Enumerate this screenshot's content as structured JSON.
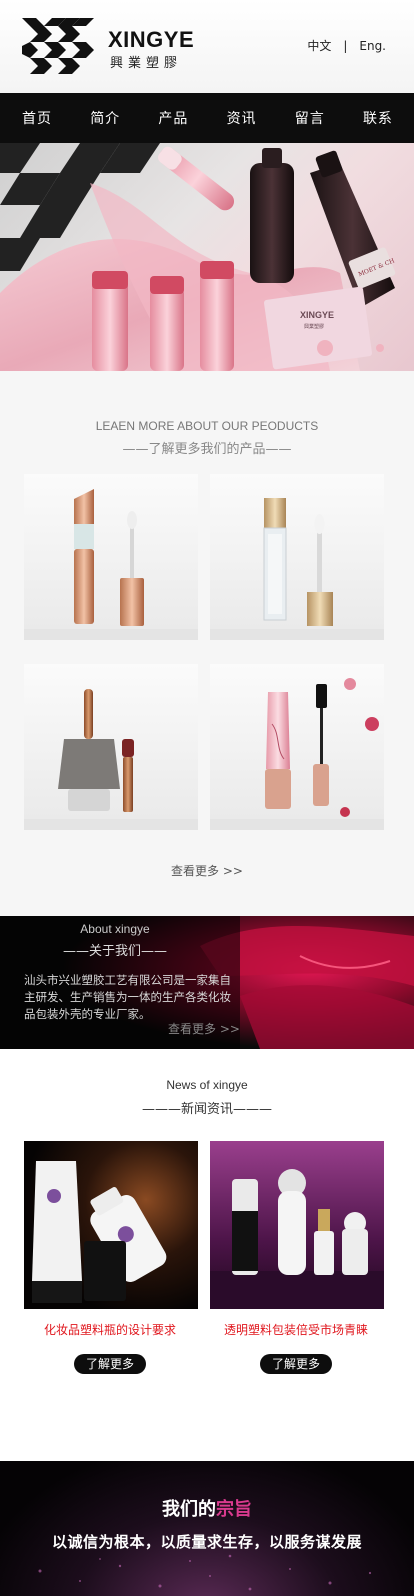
{
  "header": {
    "brand": "XINGYE",
    "brand_cn": "興業塑膠",
    "lang_cn": "中文",
    "lang_sep": "|",
    "lang_en": "Eng."
  },
  "nav": [
    "首页",
    "简介",
    "产品",
    "资讯",
    "留言",
    "联系"
  ],
  "banner": {
    "box_brand": "XINGYE",
    "box_brand_cn": "興業塑膠",
    "bottle_label": "MOET & CH"
  },
  "products": {
    "title_en": "LEAEN MORE ABOUT OUR PEODUCTS",
    "title_cn": "——了解更多我们的产品——",
    "more": "查看更多 >>"
  },
  "about": {
    "title_en": "About xingye",
    "title_cn": "——关于我们——",
    "text": "汕头市兴业塑胶工艺有限公司是一家集自主研发、生产销售为一体的生产各类化妆品包装外壳的专业厂家。",
    "more": "查看更多 >>"
  },
  "news": {
    "title_en": "News of xingye",
    "title_cn": "———新闻资讯———",
    "items": [
      {
        "title": "化妆品塑料瓶的设计要求",
        "button": "了解更多"
      },
      {
        "title": "透明塑料包装倍受市场青睐",
        "button": "了解更多"
      }
    ]
  },
  "footer": {
    "title_plain": "我们的",
    "title_accent": "宗旨",
    "slogan": "以诚信为根本，以质量求生存，以服务谋发展"
  },
  "colors": {
    "nav_bg": "#0d0d0d",
    "news_title": "#e0161d",
    "footer_accent": "#d93a8e"
  }
}
